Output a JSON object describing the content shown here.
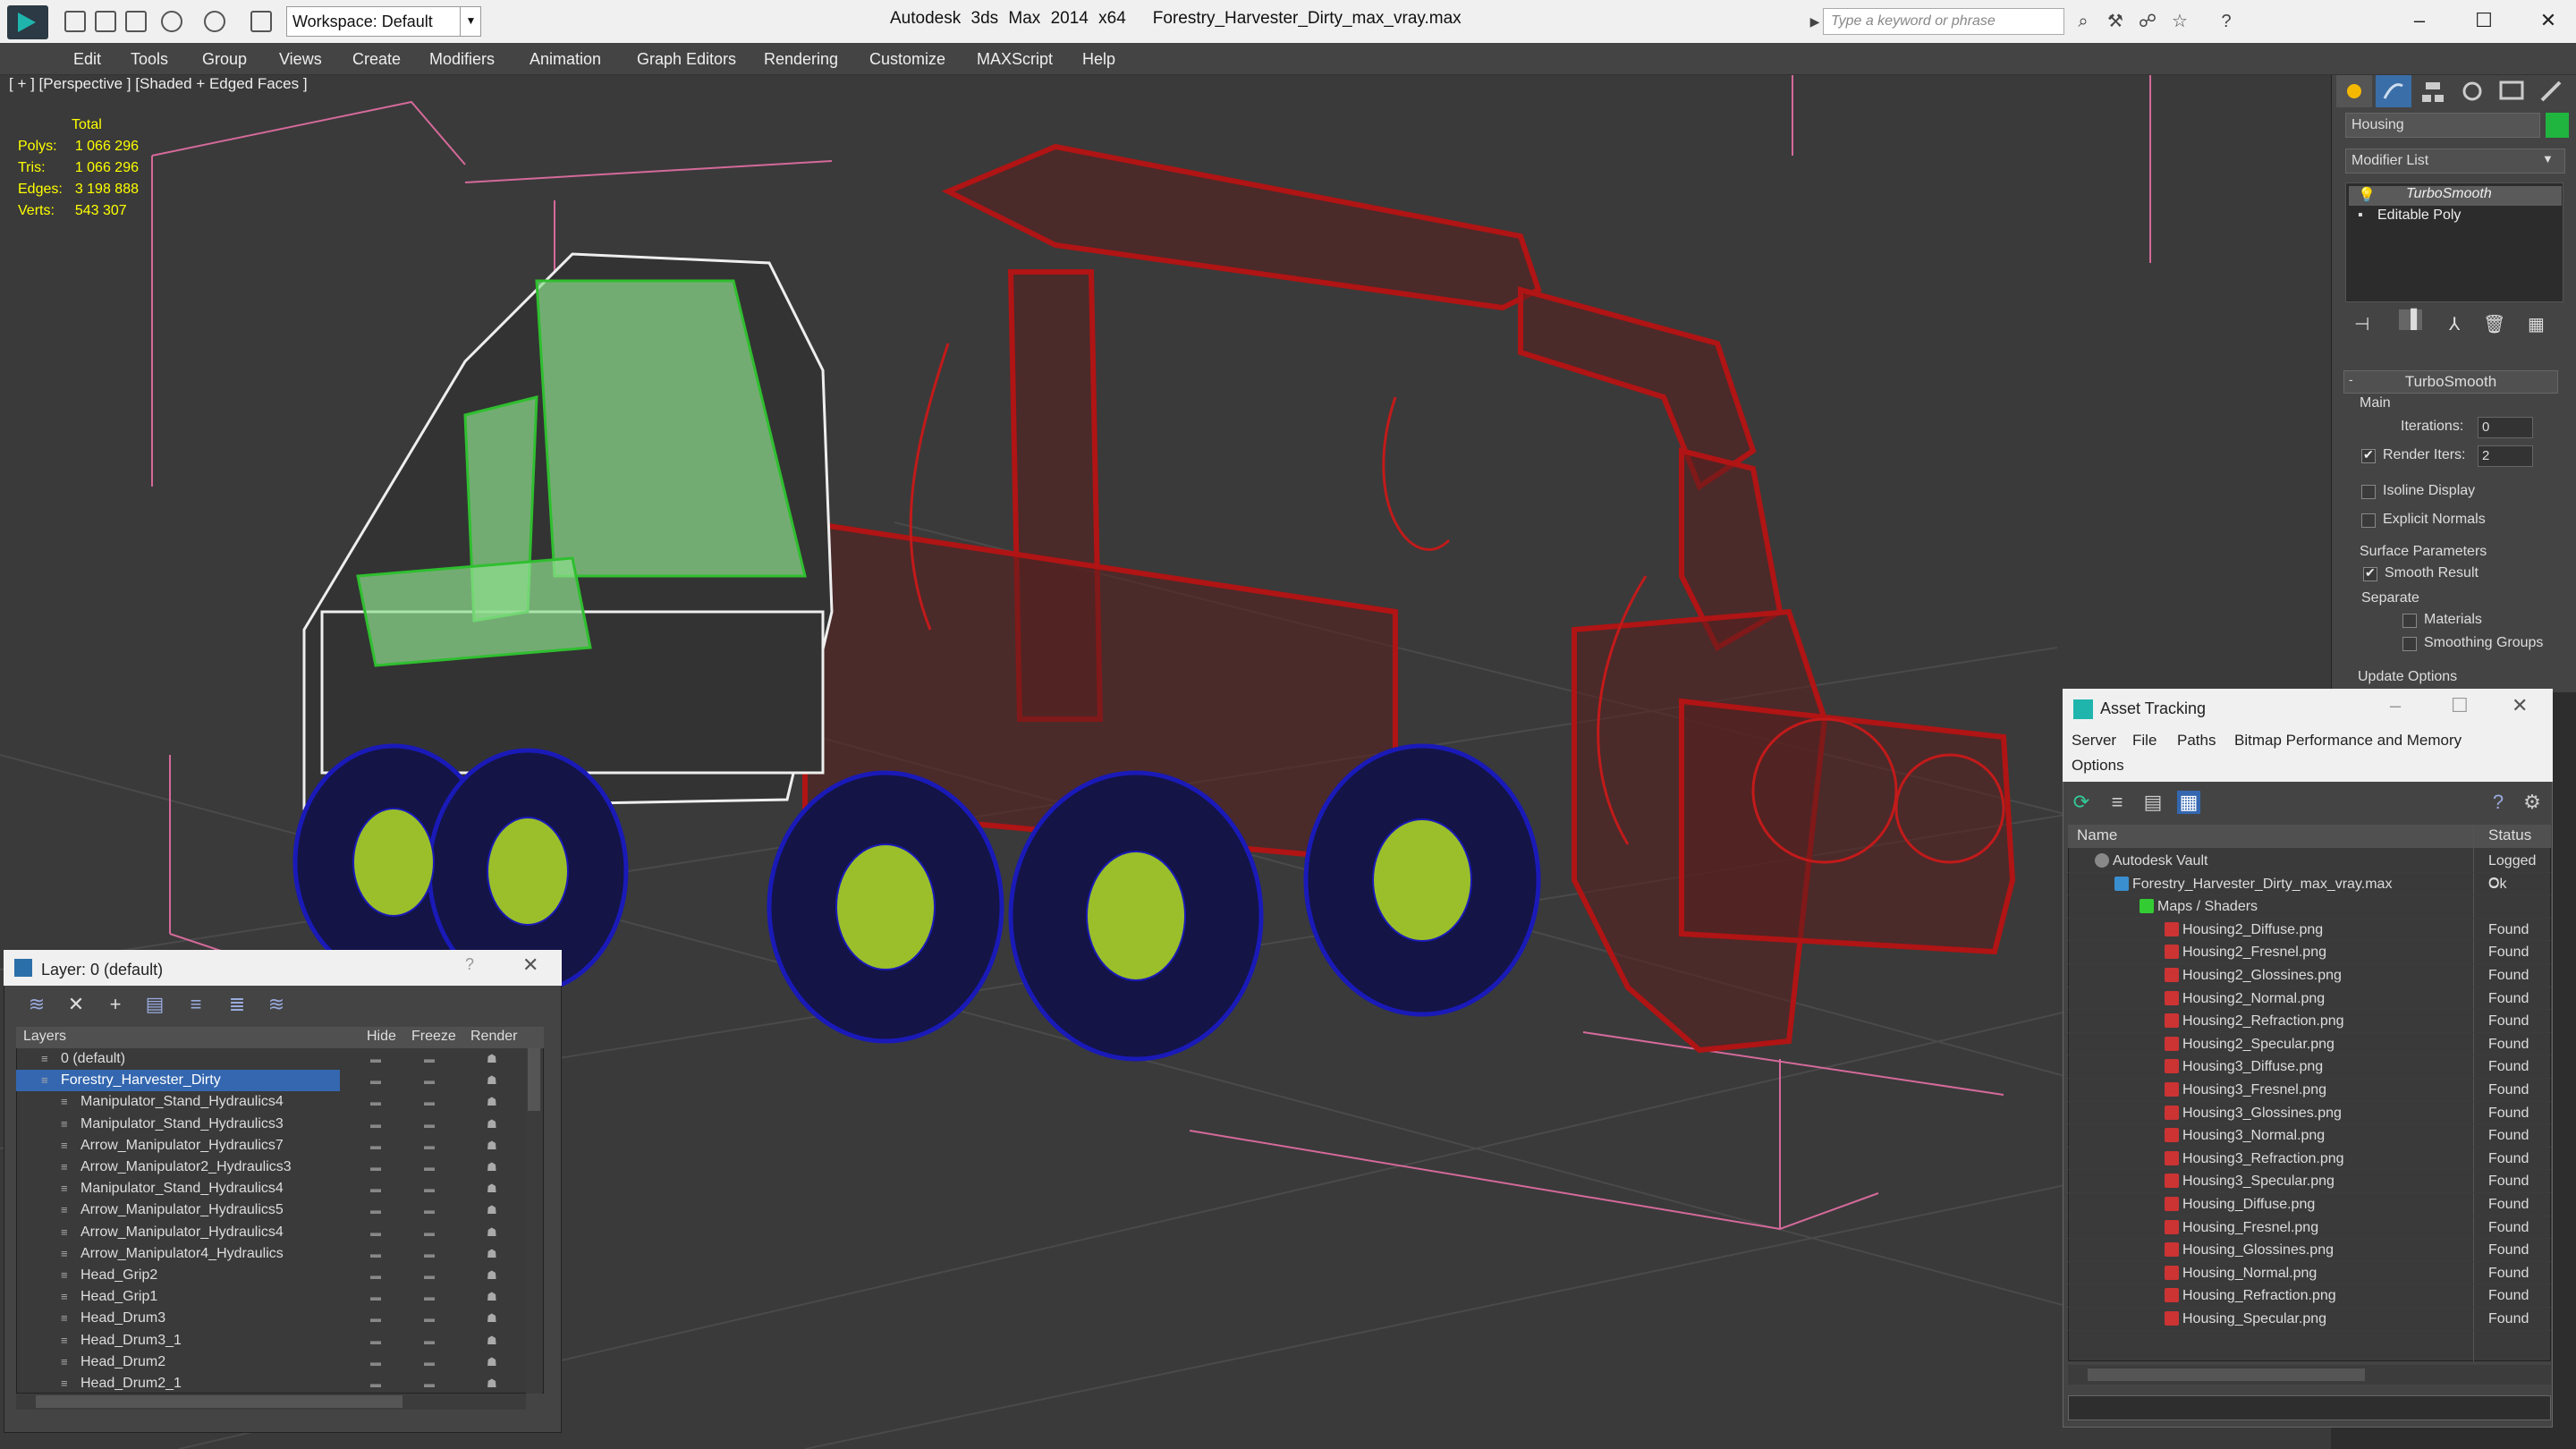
{
  "app": {
    "title": "Autodesk 3ds Max  2014 x64",
    "file": "Forestry_Harvester_Dirty_max_vray.max",
    "workspace": "Workspace: Default",
    "search_placeholder": "Type a keyword or phrase"
  },
  "menu": [
    "Edit",
    "Tools",
    "Group",
    "Views",
    "Create",
    "Modifiers",
    "Animation",
    "Graph Editors",
    "Rendering",
    "Customize",
    "MAXScript",
    "Help"
  ],
  "viewport": {
    "label": "[ + ] [Perspective ] [Shaded + Edged Faces ]",
    "stats_header": "Total",
    "stats": [
      {
        "k": "Polys:",
        "v": "1 066 296"
      },
      {
        "k": "Tris:",
        "v": "1 066 296"
      },
      {
        "k": "Edges:",
        "v": "3 198 888"
      },
      {
        "k": "Verts:",
        "v": "543 307"
      }
    ]
  },
  "command_panel": {
    "object_name": "Housing",
    "modifier_list": "Modifier List",
    "stack": [
      "TurboSmooth",
      "Editable Poly"
    ],
    "rollout": "TurboSmooth",
    "main": "Main",
    "iterations_label": "Iterations:",
    "iterations_value": "0",
    "render_iters_label": "Render Iters:",
    "render_iters_value": "2",
    "isoline": "Isoline Display",
    "explicit": "Explicit Normals",
    "surface": "Surface Parameters",
    "smooth": "Smooth Result",
    "separate": "Separate",
    "materials": "Materials",
    "smoothing_groups": "Smoothing Groups",
    "update": "Update Options"
  },
  "layer_panel": {
    "title": "Layer: 0 (default)",
    "help": "?",
    "columns": {
      "layers": "Layers",
      "hide": "Hide",
      "freeze": "Freeze",
      "render": "Render"
    },
    "rows": [
      {
        "name": "0 (default)",
        "level": 1
      },
      {
        "name": "Forestry_Harvester_Dirty",
        "level": 1
      },
      {
        "name": "Manipulator_Stand_Hydraulics4",
        "level": 2
      },
      {
        "name": "Manipulator_Stand_Hydraulics3",
        "level": 2
      },
      {
        "name": "Arrow_Manipulator_Hydraulics7",
        "level": 2
      },
      {
        "name": "Arrow_Manipulator2_Hydraulics3",
        "level": 2
      },
      {
        "name": "Manipulator_Stand_Hydraulics4",
        "level": 2
      },
      {
        "name": "Arrow_Manipulator_Hydraulics5",
        "level": 2
      },
      {
        "name": "Arrow_Manipulator_Hydraulics4",
        "level": 2
      },
      {
        "name": "Arrow_Manipulator4_Hydraulics",
        "level": 2
      },
      {
        "name": "Head_Grip2",
        "level": 2
      },
      {
        "name": "Head_Grip1",
        "level": 2
      },
      {
        "name": "Head_Drum3",
        "level": 2
      },
      {
        "name": "Head_Drum3_1",
        "level": 2
      },
      {
        "name": "Head_Drum2",
        "level": 2
      },
      {
        "name": "Head_Drum2_1",
        "level": 2
      }
    ]
  },
  "asset_tracking": {
    "title": "Asset Tracking",
    "menu": [
      "Server",
      "File",
      "Paths",
      "Bitmap Performance and Memory"
    ],
    "menu2": "Options",
    "columns": {
      "name": "Name",
      "status": "Status"
    },
    "rows": [
      {
        "name": "Autodesk Vault",
        "status": "Logged O",
        "level": 1
      },
      {
        "name": "Forestry_Harvester_Dirty_max_vray.max",
        "status": "Ok",
        "level": 2
      },
      {
        "name": "Maps / Shaders",
        "status": "",
        "level": 3
      },
      {
        "name": "Housing2_Diffuse.png",
        "status": "Found",
        "level": 4
      },
      {
        "name": "Housing2_Fresnel.png",
        "status": "Found",
        "level": 4
      },
      {
        "name": "Housing2_Glossines.png",
        "status": "Found",
        "level": 4
      },
      {
        "name": "Housing2_Normal.png",
        "status": "Found",
        "level": 4
      },
      {
        "name": "Housing2_Refraction.png",
        "status": "Found",
        "level": 4
      },
      {
        "name": "Housing2_Specular.png",
        "status": "Found",
        "level": 4
      },
      {
        "name": "Housing3_Diffuse.png",
        "status": "Found",
        "level": 4
      },
      {
        "name": "Housing3_Fresnel.png",
        "status": "Found",
        "level": 4
      },
      {
        "name": "Housing3_Glossines.png",
        "status": "Found",
        "level": 4
      },
      {
        "name": "Housing3_Normal.png",
        "status": "Found",
        "level": 4
      },
      {
        "name": "Housing3_Refraction.png",
        "status": "Found",
        "level": 4
      },
      {
        "name": "Housing3_Specular.png",
        "status": "Found",
        "level": 4
      },
      {
        "name": "Housing_Diffuse.png",
        "status": "Found",
        "level": 4
      },
      {
        "name": "Housing_Fresnel.png",
        "status": "Found",
        "level": 4
      },
      {
        "name": "Housing_Glossines.png",
        "status": "Found",
        "level": 4
      },
      {
        "name": "Housing_Normal.png",
        "status": "Found",
        "level": 4
      },
      {
        "name": "Housing_Refraction.png",
        "status": "Found",
        "level": 4
      },
      {
        "name": "Housing_Specular.png",
        "status": "Found",
        "level": 4
      }
    ]
  }
}
